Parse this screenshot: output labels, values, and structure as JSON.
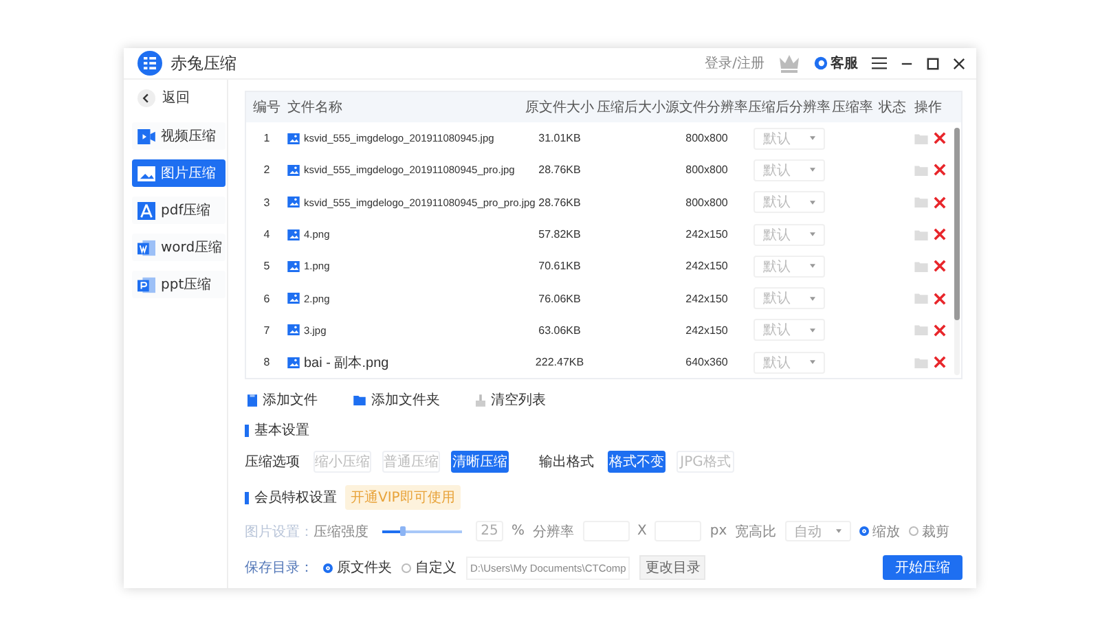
{
  "window": {
    "title": "赤兔压缩",
    "login": "登录/注册",
    "support": "客服"
  },
  "sidebar": {
    "back": "返回",
    "items": [
      {
        "label": "视频压缩",
        "selected": false,
        "kind": "video"
      },
      {
        "label": "图片压缩",
        "selected": true,
        "kind": "image"
      },
      {
        "label": "pdf压缩",
        "selected": false,
        "kind": "pdf"
      },
      {
        "label": "word压缩",
        "selected": false,
        "kind": "word"
      },
      {
        "label": "ppt压缩",
        "selected": false,
        "kind": "ppt"
      }
    ]
  },
  "table": {
    "columns": [
      "编号",
      "文件名称",
      "原文件大小",
      "压缩后大小",
      "源文件分辨率",
      "压缩后分辨率",
      "压缩率",
      "状态",
      "操作"
    ],
    "rows": [
      {
        "index": "1",
        "name": "ksvid_555_imgdelogo_201911080945.jpg",
        "original_size": "31.01KB",
        "source_resolution": "800x800",
        "output_resolution": "默认"
      },
      {
        "index": "2",
        "name": "ksvid_555_imgdelogo_201911080945_pro.jpg",
        "original_size": "28.76KB",
        "source_resolution": "800x800",
        "output_resolution": "默认"
      },
      {
        "index": "3",
        "name": "ksvid_555_imgdelogo_201911080945_pro_pro.jpg",
        "original_size": "28.76KB",
        "source_resolution": "800x800",
        "output_resolution": "默认"
      },
      {
        "index": "4",
        "name": "4.png",
        "original_size": "57.82KB",
        "source_resolution": "242x150",
        "output_resolution": "默认"
      },
      {
        "index": "5",
        "name": "1.png",
        "original_size": "70.61KB",
        "source_resolution": "242x150",
        "output_resolution": "默认"
      },
      {
        "index": "6",
        "name": "2.png",
        "original_size": "76.06KB",
        "source_resolution": "242x150",
        "output_resolution": "默认"
      },
      {
        "index": "7",
        "name": "3.jpg",
        "original_size": "63.06KB",
        "source_resolution": "242x150",
        "output_resolution": "默认"
      },
      {
        "index": "8",
        "name": "bai - 副本.png",
        "original_size": "222.47KB",
        "source_resolution": "640x360",
        "output_resolution": "默认"
      }
    ]
  },
  "toolbar": [
    {
      "label": "添加文件",
      "kind": "file"
    },
    {
      "label": "添加文件夹",
      "kind": "folder"
    },
    {
      "label": "清空列表",
      "kind": "clear"
    }
  ],
  "basic_settings": {
    "title": "基本设置",
    "compression": {
      "label": "压缩选项",
      "options": [
        {
          "label": "缩小压缩",
          "selected": false
        },
        {
          "label": "普通压缩",
          "selected": false
        },
        {
          "label": "清晰压缩",
          "selected": true
        }
      ]
    },
    "format": {
      "label": "输出格式",
      "options": [
        {
          "label": "格式不变",
          "selected": true
        },
        {
          "label": "JPG格式",
          "selected": false
        }
      ]
    }
  },
  "vip_settings": {
    "title": "会员特权设置",
    "badge": "开通VIP即可使用",
    "disabled": true,
    "label": "图片设置：",
    "strength_label": "压缩强度",
    "level": 0.25,
    "strength_value": "25",
    "unit": "%",
    "resolution_label": "分辨率",
    "times": "X",
    "px": "px",
    "aspect_label": "宽高比",
    "aspect_value": "自动",
    "modes": [
      {
        "label": "缩放",
        "selected": true
      },
      {
        "label": "裁剪",
        "selected": false
      }
    ]
  },
  "save": {
    "label": "保存目录：",
    "options": [
      {
        "label": "原文件夹",
        "selected": true
      },
      {
        "label": "自定义",
        "selected": false
      }
    ],
    "path": "D:\\Users\\My Documents\\CTComp",
    "change_button": "更改目录"
  },
  "start_button": "开始压缩"
}
